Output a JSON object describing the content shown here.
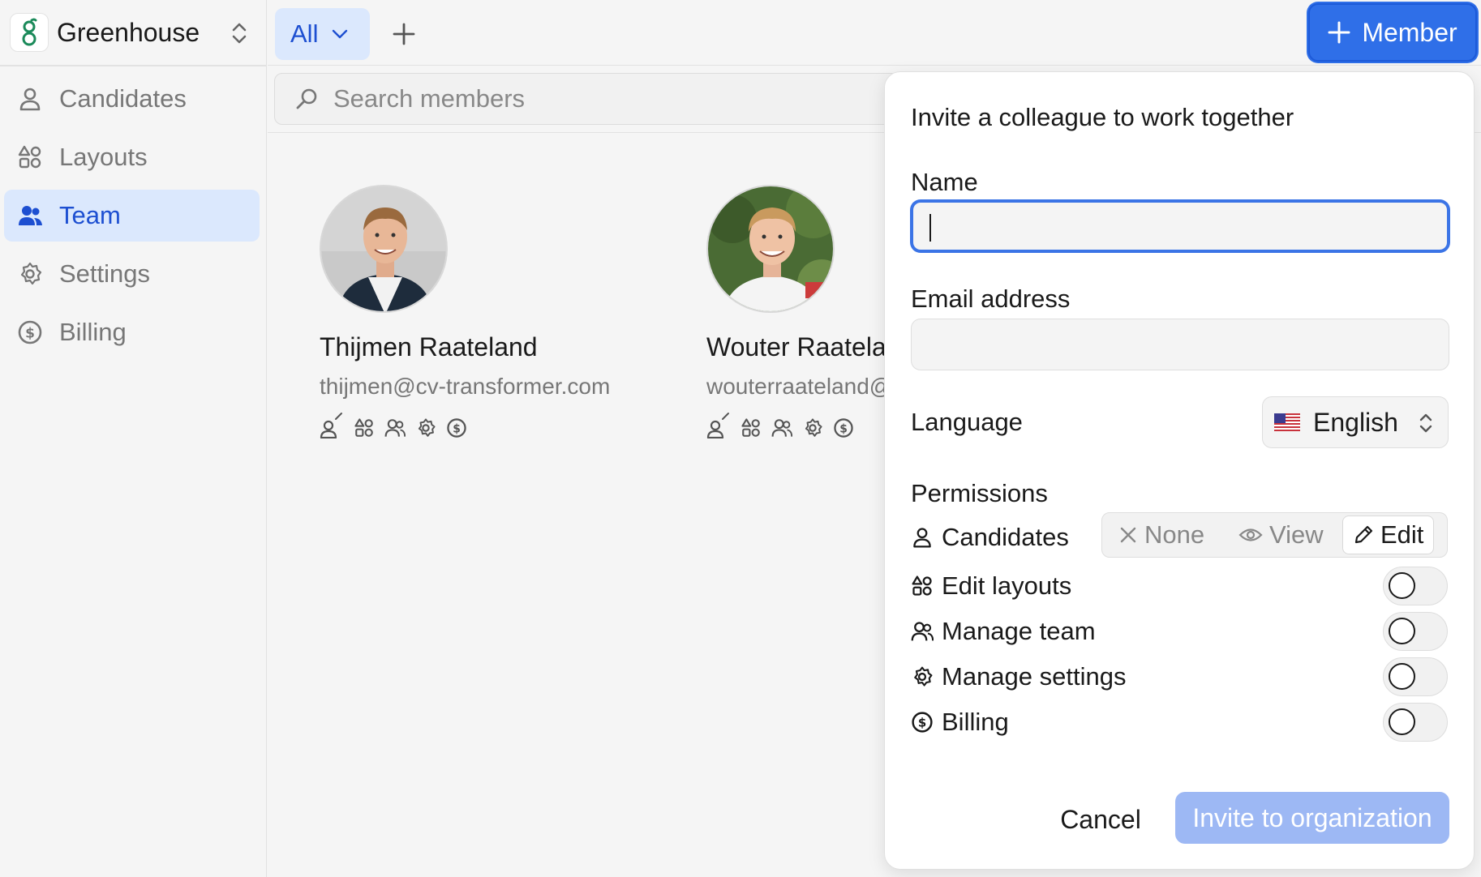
{
  "org": {
    "name": "Greenhouse"
  },
  "sidebar": {
    "items": [
      {
        "label": "Candidates",
        "icon": "user-icon",
        "active": false
      },
      {
        "label": "Layouts",
        "icon": "layouts-icon",
        "active": false
      },
      {
        "label": "Team",
        "icon": "team-icon",
        "active": true
      },
      {
        "label": "Settings",
        "icon": "gear-icon",
        "active": false
      },
      {
        "label": "Billing",
        "icon": "dollar-icon",
        "active": false
      }
    ]
  },
  "topbar": {
    "tab_label": "All",
    "member_button_label": "Member"
  },
  "search": {
    "placeholder": "Search members"
  },
  "members": [
    {
      "name": "Thijmen Raateland",
      "email": "thijmen@cv-transformer.com"
    },
    {
      "name": "Wouter Raateland",
      "email": "wouterraateland@"
    }
  ],
  "invite": {
    "title": "Invite a colleague to work together",
    "name_label": "Name",
    "name_value": "",
    "email_label": "Email address",
    "email_value": "",
    "language_label": "Language",
    "language_value": "English",
    "permissions_label": "Permissions",
    "permissions": {
      "candidates": {
        "label": "Candidates",
        "options": [
          "None",
          "View",
          "Edit"
        ],
        "selected": "Edit"
      },
      "toggles": [
        {
          "label": "Edit layouts",
          "icon": "layouts-icon",
          "on": false
        },
        {
          "label": "Manage team",
          "icon": "team-icon",
          "on": false
        },
        {
          "label": "Manage settings",
          "icon": "gear-icon",
          "on": false
        },
        {
          "label": "Billing",
          "icon": "dollar-icon",
          "on": false
        }
      ]
    },
    "cancel_label": "Cancel",
    "submit_label": "Invite to organization"
  },
  "colors": {
    "accent": "#2f6fe8",
    "active_bg": "#dbe8fd",
    "active_text": "#1d4fd1",
    "brand_green": "#1b8a5a",
    "disabled_button": "#9db8f4"
  }
}
